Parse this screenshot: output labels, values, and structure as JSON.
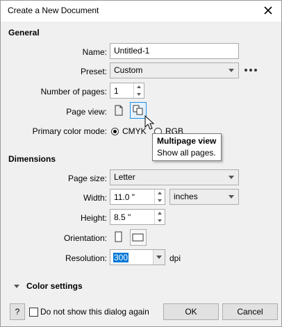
{
  "dialog": {
    "title": "Create a New Document"
  },
  "general": {
    "heading": "General",
    "name_label": "Name:",
    "name_value": "Untitled-1",
    "preset_label": "Preset:",
    "preset_value": "Custom",
    "pages_label": "Number of pages:",
    "pages_value": "1",
    "pageview_label": "Page view:",
    "colormode_label": "Primary color mode:",
    "cmyk": "CMYK",
    "rgb": "RGB"
  },
  "tooltip": {
    "title": "Multipage view",
    "text": "Show all pages."
  },
  "dimensions": {
    "heading": "Dimensions",
    "pagesize_label": "Page size:",
    "pagesize_value": "Letter",
    "width_label": "Width:",
    "width_value": "11.0 \"",
    "units_value": "inches",
    "height_label": "Height:",
    "height_value": "8.5 \"",
    "orientation_label": "Orientation:",
    "resolution_label": "Resolution:",
    "resolution_value": "300",
    "resolution_unit": "dpi"
  },
  "color_settings": {
    "label": "Color settings"
  },
  "footer": {
    "help_label": "?",
    "dont_show_label": "Do not show this dialog again",
    "ok_label": "OK",
    "cancel_label": "Cancel"
  }
}
